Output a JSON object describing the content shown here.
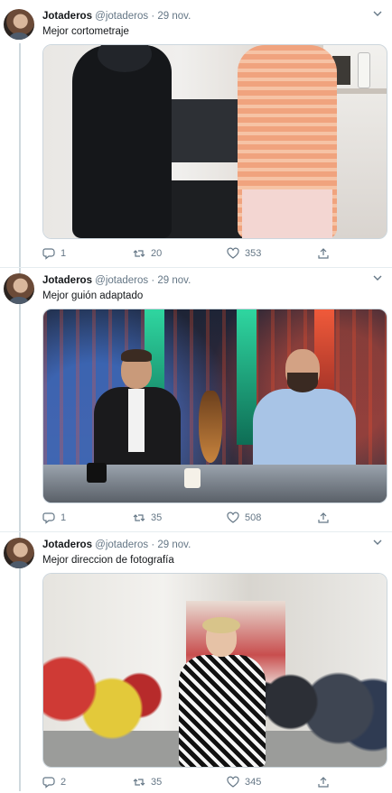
{
  "tweets": [
    {
      "name": "Jotaderos",
      "handle": "@jotaderos",
      "separator": "·",
      "date": "29 nov.",
      "text": "Mejor cortometraje",
      "replies": "1",
      "retweets": "20",
      "likes": "353"
    },
    {
      "name": "Jotaderos",
      "handle": "@jotaderos",
      "separator": "·",
      "date": "29 nov.",
      "text": "Mejor guión adaptado",
      "replies": "1",
      "retweets": "35",
      "likes": "508"
    },
    {
      "name": "Jotaderos",
      "handle": "@jotaderos",
      "separator": "·",
      "date": "29 nov.",
      "text": "Mejor direccion de fotografía",
      "replies": "2",
      "retweets": "35",
      "likes": "345"
    }
  ],
  "icons": {
    "reply": "reply-icon",
    "retweet": "retweet-icon",
    "like": "heart-icon",
    "share": "share-icon",
    "caret": "chevron-down-icon"
  },
  "colors": {
    "secondary_text": "#657786",
    "thread_line": "#cfd9de",
    "border": "#e6ecf0"
  }
}
